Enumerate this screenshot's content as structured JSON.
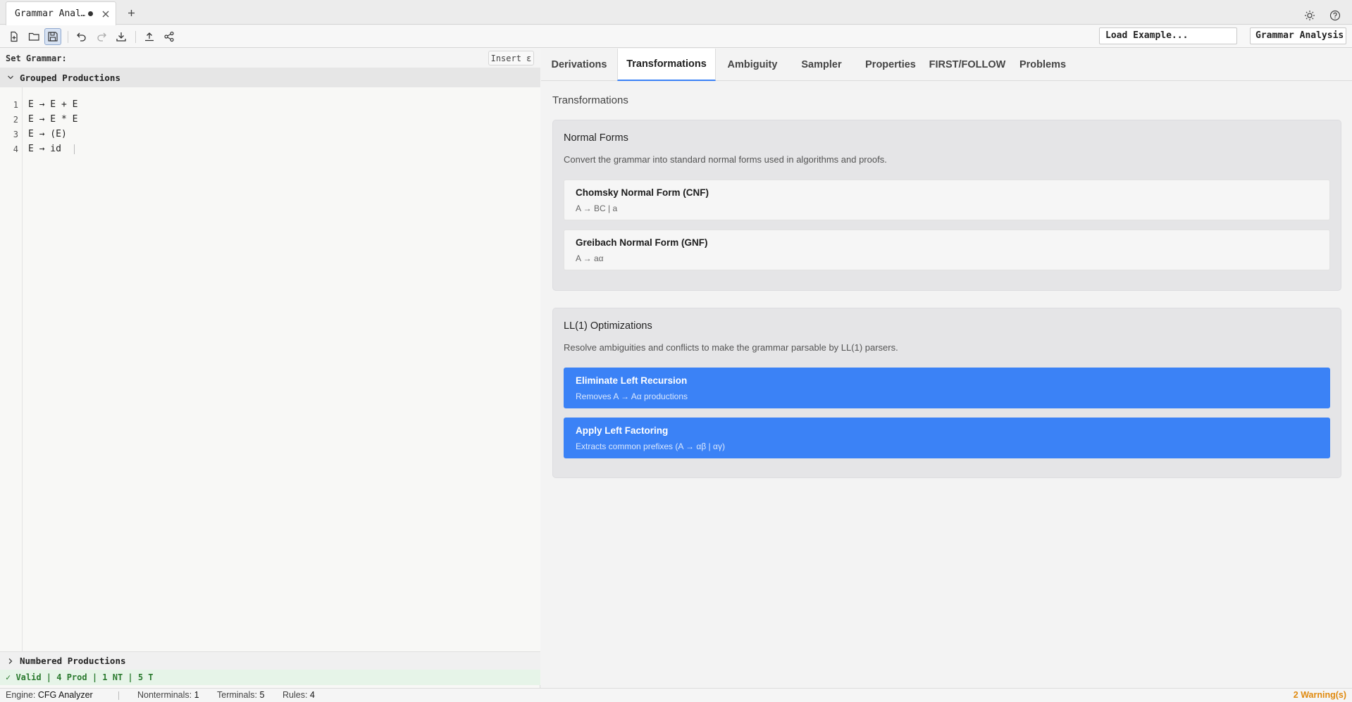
{
  "tabbar": {
    "file_tab_title": "Grammar Anal…",
    "icons": {
      "close": "close-icon",
      "new_tab": "plus-icon",
      "theme": "sun-icon",
      "help": "question-circle-icon"
    }
  },
  "toolbar": {
    "icons": [
      "new-file-icon",
      "open-folder-icon",
      "save-icon",
      "undo-icon",
      "redo-icon",
      "download-icon",
      "upload-icon",
      "share-icon"
    ],
    "load_example_label": "Load Example...",
    "mode_label": "Grammar Analysis"
  },
  "editor": {
    "set_grammar_label": "Set Grammar:",
    "insert_epsilon_label": "Insert ε",
    "grouped_section_title": "Grouped Productions",
    "numbered_section_title": "Numbered Productions",
    "lines": [
      {
        "num": "1",
        "text": "E → E + E"
      },
      {
        "num": "2",
        "text": "E → E * E"
      },
      {
        "num": "3",
        "text": "E → (E)"
      },
      {
        "num": "4",
        "text": "E → id"
      }
    ],
    "validity": "✓ Valid | 4 Prod | 1 NT | 5 T"
  },
  "analysis": {
    "tabs": [
      "Derivations",
      "Transformations",
      "Ambiguity",
      "Sampler",
      "Properties",
      "FIRST/FOLLOW",
      "Problems"
    ],
    "active_tab": "Transformations",
    "panel_title": "Transformations",
    "normal_forms": {
      "title": "Normal Forms",
      "description": "Convert the grammar into standard normal forms used in algorithms and proofs.",
      "cards": [
        {
          "title": "Chomsky Normal Form (CNF)",
          "subtitle": "A → BC | a"
        },
        {
          "title": "Greibach Normal Form (GNF)",
          "subtitle": "A → aα"
        }
      ]
    },
    "ll1": {
      "title": "LL(1) Optimizations",
      "description": "Resolve ambiguities and conflicts to make the grammar parsable by LL(1) parsers.",
      "cards": [
        {
          "title": "Eliminate Left Recursion",
          "subtitle": "Removes A → Aα productions"
        },
        {
          "title": "Apply Left Factoring",
          "subtitle": "Extracts common prefixes (A → αβ | αγ)"
        }
      ]
    }
  },
  "statusbar": {
    "engine_label": "Engine:",
    "engine_value": "CFG Analyzer",
    "nonterminals_label": "Nonterminals:",
    "nonterminals_value": "1",
    "terminals_label": "Terminals:",
    "terminals_value": "5",
    "rules_label": "Rules:",
    "rules_value": "4",
    "warnings": "2 Warning(s)"
  },
  "colors": {
    "accent": "#3b82f6",
    "valid_green": "#2a7a2e",
    "warning_orange": "#e08a0f"
  }
}
